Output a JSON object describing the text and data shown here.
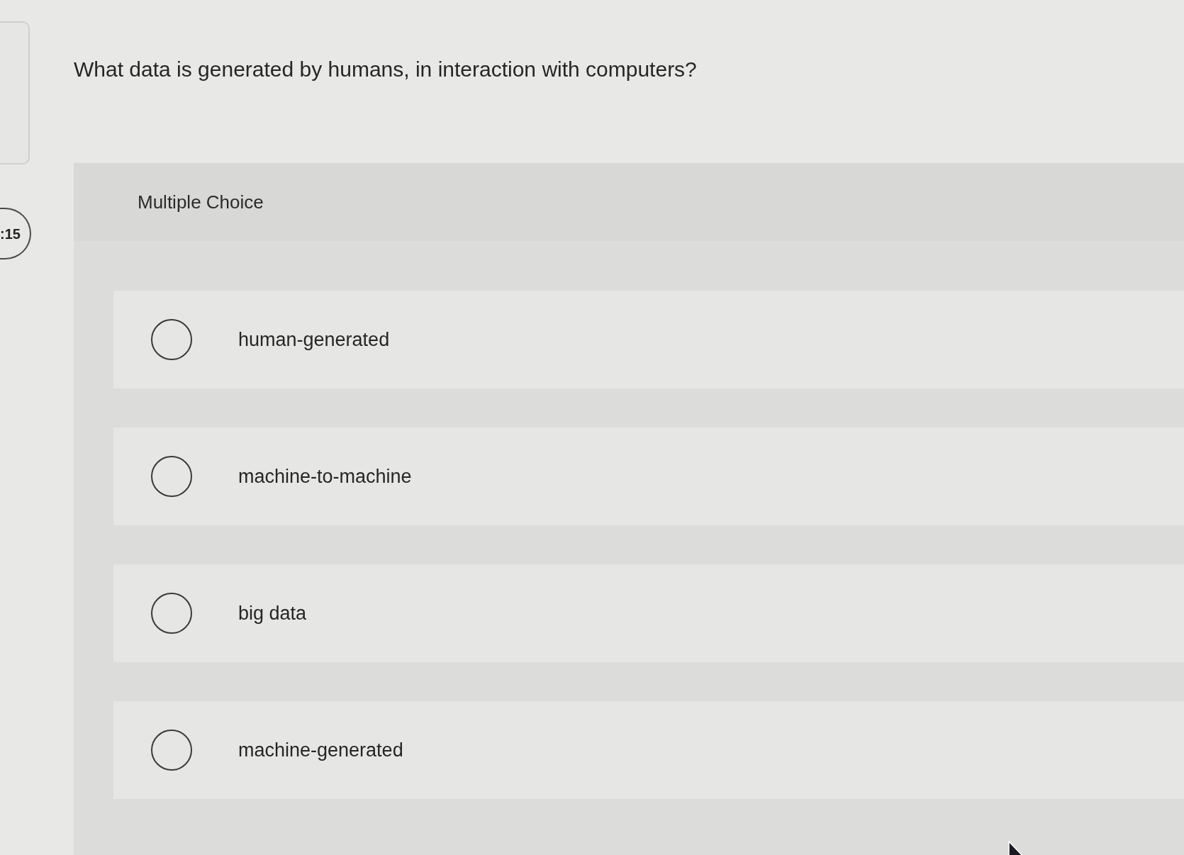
{
  "sidebar": {
    "timer": ":15"
  },
  "question": {
    "text": "What data is generated by humans, in interaction with computers?"
  },
  "answer_panel": {
    "title": "Multiple Choice",
    "options": [
      {
        "label": "human-generated",
        "selected": false
      },
      {
        "label": "machine-to-machine",
        "selected": false
      },
      {
        "label": "big data",
        "selected": false
      },
      {
        "label": "machine-generated",
        "selected": false
      }
    ]
  }
}
